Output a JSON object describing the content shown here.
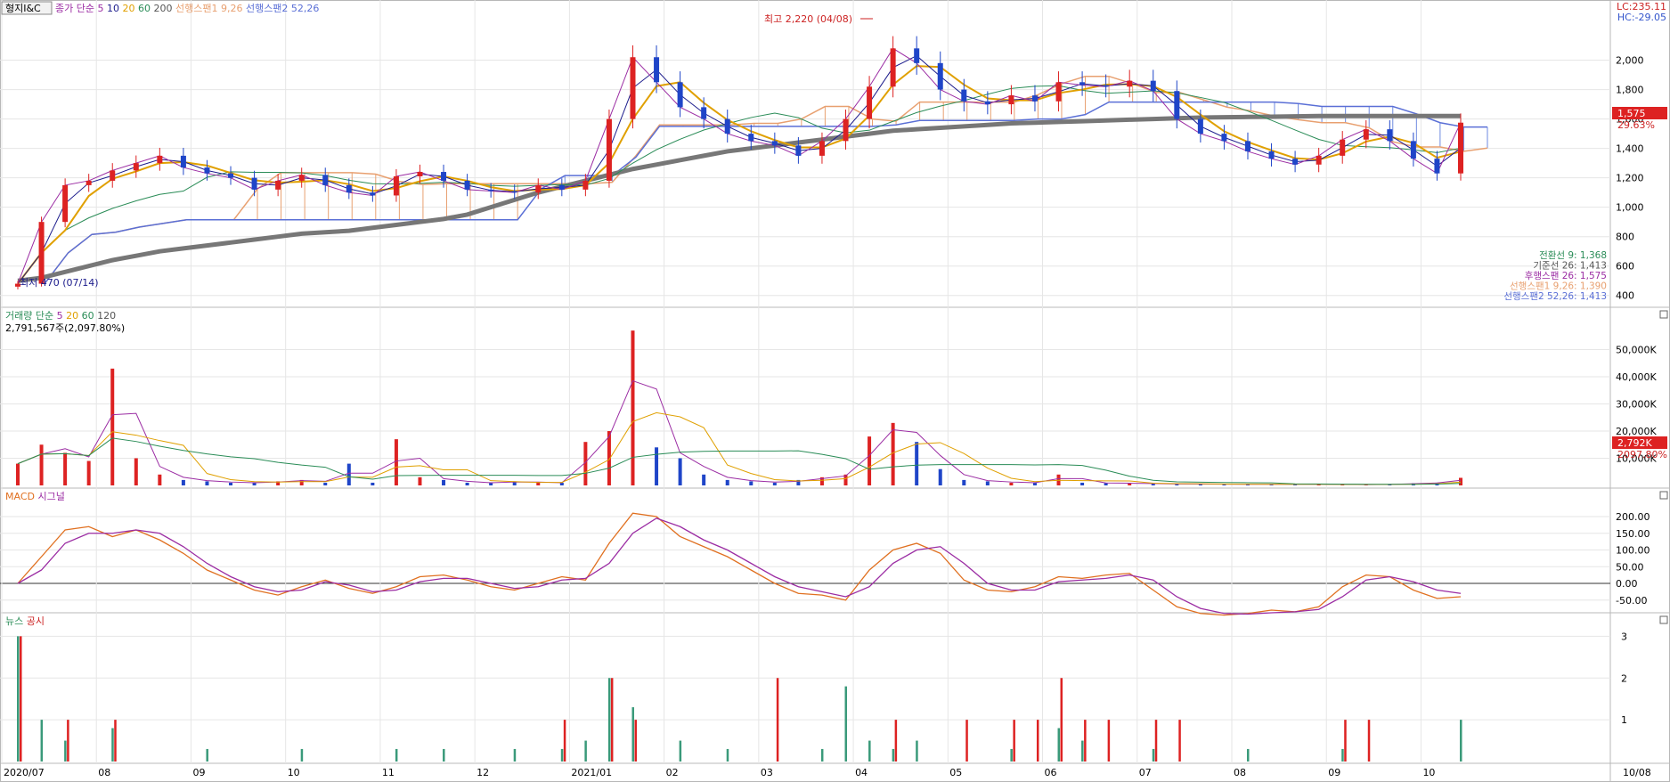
{
  "price_panel": {
    "title": "형지I&C",
    "legend": [
      {
        "text": "종가 단순 5",
        "color": "#9b2ca3"
      },
      {
        "text": "10",
        "color": "#1c1c8c"
      },
      {
        "text": "20",
        "color": "#e0a000"
      },
      {
        "text": "60",
        "color": "#2a8c57"
      },
      {
        "text": "200",
        "color": "#555555"
      },
      {
        "text": "선행스팬1 9,26",
        "color": "#e8a070"
      },
      {
        "text": "선행스팬2 52,26",
        "color": "#5a6fd6"
      }
    ],
    "lc": "LC:235.11",
    "hc": "HC:-29.05",
    "high_note": "최고 2,220 (04/08)",
    "low_note": "최저 470 (07/14)",
    "y_ticks": [
      "2,000",
      "1,800",
      "1,600",
      "1,400",
      "1,200",
      "1,000",
      "800",
      "600",
      "400"
    ],
    "current_price": "1,575",
    "current_pct": "29.63%",
    "ichimoku": [
      {
        "text": "전환선 9: 1,368",
        "color": "#2a8c57"
      },
      {
        "text": "기준선 26: 1,413",
        "color": "#555555"
      },
      {
        "text": "후행스팬 26: 1,575",
        "color": "#9b2ca3"
      },
      {
        "text": "선행스팬1 9,26: 1,390",
        "color": "#e8a070"
      },
      {
        "text": "선행스팬2 52,26: 1,413",
        "color": "#5a6fd6"
      }
    ]
  },
  "volume_panel": {
    "legend": [
      {
        "text": "거래량 단순",
        "color": "#2a8c57"
      },
      {
        "text": "5",
        "color": "#9b2ca3"
      },
      {
        "text": "20",
        "color": "#e0a000"
      },
      {
        "text": "60",
        "color": "#2a8c57"
      },
      {
        "text": "120",
        "color": "#555555"
      }
    ],
    "info": "2,791,567주(2,097.80%)",
    "y_ticks": [
      "50,000K",
      "40,000K",
      "30,000K",
      "20,000K",
      "10,000K"
    ],
    "current": "2,792K",
    "current_pct": "2097.80%"
  },
  "macd_panel": {
    "legend": [
      {
        "text": "MACD",
        "color": "#e07020"
      },
      {
        "text": "시그널",
        "color": "#9b2ca3"
      }
    ],
    "y_ticks": [
      "200.00",
      "150.00",
      "100.00",
      "50.00",
      "0.00",
      "-50.00"
    ]
  },
  "news_panel": {
    "legend": [
      {
        "text": "뉴스",
        "color": "#2a8c57"
      },
      {
        "text": "공시",
        "color": "#cc2222"
      }
    ],
    "y_ticks": [
      "3",
      "2",
      "1"
    ]
  },
  "x_axis": {
    "labels": [
      "2020/07",
      "08",
      "09",
      "10",
      "11",
      "12",
      "2021/01",
      "02",
      "03",
      "04",
      "05",
      "06",
      "07",
      "08",
      "09",
      "10"
    ],
    "right_label": "10/08"
  },
  "chart_data": [
    {
      "type": "candlestick",
      "title": "형지I&C",
      "ylim": [
        350,
        2300
      ],
      "x": [
        "2020/07",
        "07/2",
        "07/3",
        "07/4",
        "08",
        "08/2",
        "08/3",
        "08/4",
        "09",
        "09/2",
        "09/3",
        "09/4",
        "10",
        "10/2",
        "10/3",
        "10/4",
        "11",
        "11/2",
        "11/3",
        "11/4",
        "12",
        "12/2",
        "12/3",
        "12/4",
        "2021/01",
        "01/2",
        "01/3",
        "01/4",
        "02",
        "02/2",
        "02/3",
        "02/4",
        "03",
        "03/2",
        "03/3",
        "03/4",
        "04",
        "04/2",
        "04/3",
        "04/4",
        "05",
        "05/2",
        "05/3",
        "05/4",
        "06",
        "06/2",
        "06/3",
        "06/4",
        "07",
        "07/2",
        "07/3",
        "07/4",
        "08",
        "08/2",
        "08/3",
        "08/4",
        "09",
        "09/2",
        "09/3",
        "09/4",
        "10",
        "10/08"
      ],
      "close": [
        480,
        900,
        1150,
        1180,
        1250,
        1300,
        1350,
        1270,
        1230,
        1200,
        1120,
        1180,
        1220,
        1150,
        1100,
        1080,
        1210,
        1240,
        1180,
        1120,
        1110,
        1100,
        1150,
        1120,
        1180,
        1600,
        2020,
        1850,
        1680,
        1600,
        1500,
        1450,
        1420,
        1350,
        1450,
        1600,
        1820,
        2080,
        1980,
        1800,
        1720,
        1700,
        1760,
        1720,
        1850,
        1830,
        1820,
        1860,
        1790,
        1600,
        1500,
        1450,
        1380,
        1330,
        1290,
        1350,
        1460,
        1530,
        1450,
        1330,
        1230,
        1575
      ],
      "ma200": [
        500,
        520,
        560,
        600,
        640,
        670,
        700,
        720,
        740,
        760,
        780,
        800,
        820,
        830,
        840,
        860,
        880,
        900,
        920,
        950,
        1000,
        1050,
        1100,
        1140,
        1180,
        1220,
        1260,
        1290,
        1320,
        1350,
        1380,
        1400,
        1420,
        1440,
        1460,
        1480,
        1500,
        1520,
        1530,
        1540,
        1550,
        1560,
        1570,
        1575,
        1580,
        1585,
        1590,
        1595,
        1600,
        1605,
        1610,
        1612,
        1614,
        1616,
        1618,
        1620,
        1620,
        1620,
        1620,
        1620,
        1620,
        1620
      ]
    },
    {
      "type": "bar",
      "title": "거래량",
      "ylim": [
        0,
        60000
      ],
      "x": [
        "2020/07",
        "07/2",
        "07/3",
        "07/4",
        "08",
        "08/2",
        "08/3",
        "08/4",
        "09",
        "09/2",
        "09/3",
        "09/4",
        "10",
        "10/2",
        "10/3",
        "10/4",
        "11",
        "11/2",
        "11/3",
        "11/4",
        "12",
        "12/2",
        "12/3",
        "12/4",
        "2021/01",
        "01/2",
        "01/3",
        "01/4",
        "02",
        "02/2",
        "02/3",
        "02/4",
        "03",
        "03/2",
        "03/3",
        "03/4",
        "04",
        "04/2",
        "04/3",
        "04/4",
        "05",
        "05/2",
        "05/3",
        "05/4",
        "06",
        "06/2",
        "06/3",
        "06/4",
        "07",
        "07/2",
        "07/3",
        "07/4",
        "08",
        "08/2",
        "08/3",
        "08/4",
        "09",
        "09/2",
        "09/3",
        "09/4",
        "10",
        "10/08"
      ],
      "values": [
        8000,
        15000,
        12000,
        9000,
        43000,
        10000,
        4000,
        2000,
        1500,
        1000,
        1000,
        1500,
        2000,
        1000,
        8000,
        1000,
        17000,
        3000,
        2000,
        1000,
        1000,
        1500,
        1000,
        1000,
        16000,
        20000,
        57000,
        14000,
        10000,
        4000,
        2000,
        1500,
        1000,
        2000,
        3000,
        4000,
        18000,
        23000,
        16000,
        6000,
        2000,
        1500,
        1000,
        1000,
        4000,
        1000,
        800,
        800,
        600,
        500,
        500,
        400,
        400,
        400,
        400,
        400,
        300,
        300,
        400,
        800,
        1000,
        2792
      ]
    },
    {
      "type": "line",
      "title": "MACD",
      "ylim": [
        -80,
        240
      ],
      "x": [
        "2020/07",
        "07/2",
        "07/3",
        "07/4",
        "08",
        "08/2",
        "08/3",
        "08/4",
        "09",
        "09/2",
        "09/3",
        "09/4",
        "10",
        "10/2",
        "10/3",
        "10/4",
        "11",
        "11/2",
        "11/3",
        "11/4",
        "12",
        "12/2",
        "12/3",
        "12/4",
        "2021/01",
        "01/2",
        "01/3",
        "01/4",
        "02",
        "02/2",
        "02/3",
        "02/4",
        "03",
        "03/2",
        "03/3",
        "03/4",
        "04",
        "04/2",
        "04/3",
        "04/4",
        "05",
        "05/2",
        "05/3",
        "05/4",
        "06",
        "06/2",
        "06/3",
        "06/4",
        "07",
        "07/2",
        "07/3",
        "07/4",
        "08",
        "08/2",
        "08/3",
        "08/4",
        "09",
        "09/2",
        "09/3",
        "09/4",
        "10",
        "10/08"
      ],
      "series": [
        {
          "name": "MACD",
          "values": [
            0,
            80,
            160,
            170,
            140,
            160,
            130,
            90,
            40,
            10,
            -20,
            -35,
            -10,
            10,
            -15,
            -30,
            -10,
            20,
            25,
            10,
            -10,
            -20,
            0,
            20,
            10,
            120,
            210,
            200,
            140,
            110,
            80,
            40,
            0,
            -30,
            -35,
            -50,
            40,
            100,
            120,
            90,
            10,
            -20,
            -25,
            -10,
            20,
            15,
            25,
            30,
            -20,
            -70,
            -90,
            -95,
            -90,
            -80,
            -85,
            -70,
            -10,
            25,
            20,
            -20,
            -45,
            -40
          ]
        },
        {
          "name": "시그널",
          "values": [
            0,
            40,
            120,
            150,
            150,
            160,
            150,
            110,
            60,
            20,
            -10,
            -25,
            -20,
            5,
            -5,
            -25,
            -20,
            5,
            15,
            15,
            0,
            -15,
            -10,
            10,
            15,
            60,
            150,
            195,
            170,
            130,
            100,
            60,
            20,
            -10,
            -25,
            -40,
            -10,
            60,
            100,
            110,
            60,
            0,
            -20,
            -20,
            5,
            10,
            15,
            25,
            10,
            -40,
            -75,
            -90,
            -92,
            -88,
            -85,
            -78,
            -40,
            10,
            20,
            5,
            -20,
            -30
          ]
        }
      ]
    },
    {
      "type": "bar",
      "title": "뉴스 공시",
      "ylim": [
        0,
        3.2
      ],
      "x": [
        "2020/07",
        "07/2",
        "07/3",
        "07/4",
        "08",
        "08/2",
        "08/3",
        "08/4",
        "09",
        "09/2",
        "09/3",
        "09/4",
        "10",
        "10/2",
        "10/3",
        "10/4",
        "11",
        "11/2",
        "11/3",
        "11/4",
        "12",
        "12/2",
        "12/3",
        "12/4",
        "2021/01",
        "01/2",
        "01/3",
        "01/4",
        "02",
        "02/2",
        "02/3",
        "02/4",
        "03",
        "03/2",
        "03/3",
        "03/4",
        "04",
        "04/2",
        "04/3",
        "04/4",
        "05",
        "05/2",
        "05/3",
        "05/4",
        "06",
        "06/2",
        "06/3",
        "06/4",
        "07",
        "07/2",
        "07/3",
        "07/4",
        "08",
        "08/2",
        "08/3",
        "08/4",
        "09",
        "09/2",
        "09/3",
        "09/4",
        "10",
        "10/08"
      ],
      "series": [
        {
          "name": "뉴스",
          "values": [
            3,
            1,
            0.5,
            0,
            0.8,
            0,
            0,
            0,
            0.3,
            0,
            0,
            0,
            0.3,
            0,
            0,
            0,
            0.3,
            0,
            0.3,
            0,
            0,
            0.3,
            0,
            0.3,
            0.5,
            2,
            1.3,
            0,
            0.5,
            0,
            0.3,
            0,
            0,
            0,
            0.3,
            1.8,
            0.5,
            0.3,
            0.5,
            0,
            0,
            0,
            0.3,
            0,
            0.8,
            0.5,
            0,
            0,
            0.3,
            0,
            0,
            0,
            0.3,
            0,
            0,
            0,
            0.3,
            0,
            0,
            0,
            0,
            1
          ]
        },
        {
          "name": "공시",
          "values": [
            3,
            0,
            1,
            0,
            1,
            0,
            0,
            0,
            0,
            0,
            0,
            0,
            0,
            0,
            0,
            0,
            0,
            0,
            0,
            0,
            0,
            0,
            0,
            1,
            0,
            2,
            1,
            0,
            0,
            0,
            0,
            0,
            2,
            0,
            0,
            0,
            0,
            1,
            0,
            0,
            1,
            0,
            1,
            1,
            2,
            1,
            1,
            0,
            1,
            1,
            0,
            0,
            0,
            0,
            0,
            0,
            1,
            1,
            0,
            0,
            0,
            0
          ]
        }
      ]
    }
  ]
}
